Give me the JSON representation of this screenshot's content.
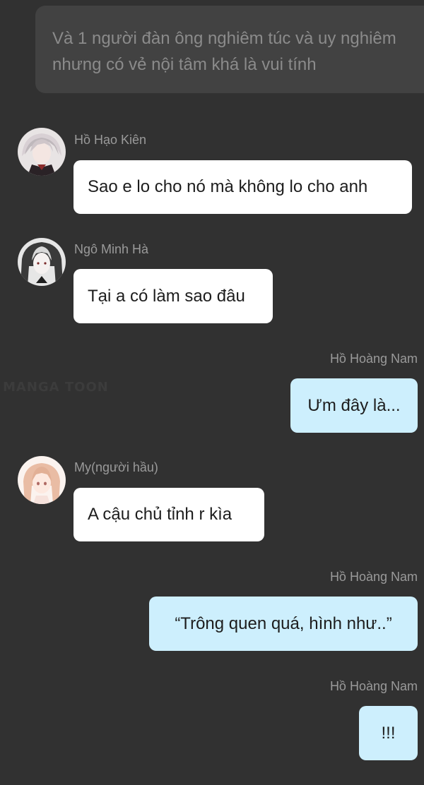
{
  "narration": {
    "text": "Và 1 người đàn ông nghiêm túc và uy nghiêm\nnhưng có vẻ nội tâm khá là vui tính"
  },
  "watermark": {
    "text": "MANGA TOON"
  },
  "messages": [
    {
      "sender": "Hồ Hạo Kiên",
      "text": "Sao e lo cho nó mà không lo cho anh",
      "side": "left",
      "avatar": "avatar-ho-hao-kien"
    },
    {
      "sender": "Ngô Minh Hà",
      "text": "Tại a có làm sao đâu",
      "side": "left",
      "avatar": "avatar-ngo-minh-ha"
    },
    {
      "sender": "Hồ Hoàng Nam",
      "text": "Ưm đây là...",
      "side": "right"
    },
    {
      "sender": "My(người hầu)",
      "text": "A cậu chủ tỉnh r kìa",
      "side": "left",
      "avatar": "avatar-my"
    },
    {
      "sender": "Hồ Hoàng Nam",
      "text": "“Trông quen quá, hình như..”",
      "side": "right"
    },
    {
      "sender": "Hồ Hoàng Nam",
      "text": "!!!",
      "side": "right"
    }
  ],
  "colors": {
    "background": "#313131",
    "narration_bg": "#424242",
    "incoming_bubble": "#ffffff",
    "outgoing_bubble": "#cdeffd",
    "sender_text": "#9a9a9a"
  }
}
